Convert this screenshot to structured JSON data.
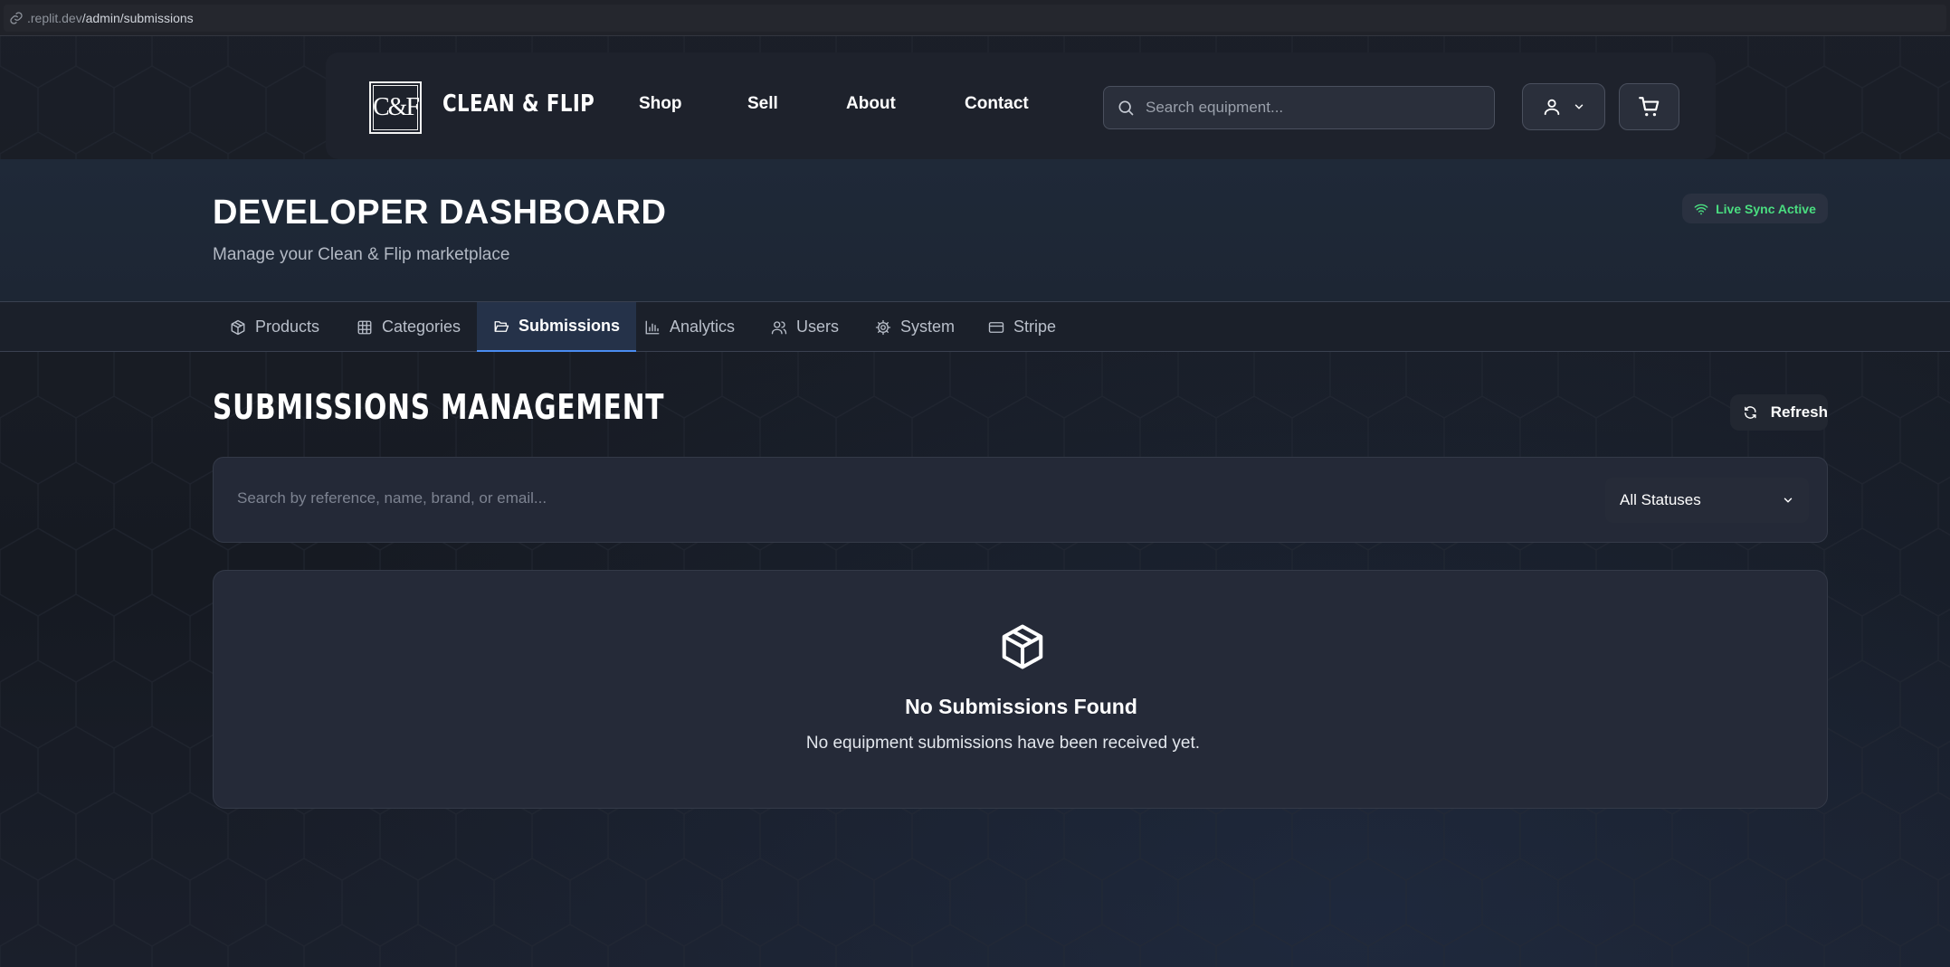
{
  "browser": {
    "url_prefix": ".replit.dev",
    "url_path": "/admin/submissions"
  },
  "header": {
    "logo_text": "C&F",
    "brand": "CLEAN & FLIP",
    "nav": [
      "Shop",
      "Sell",
      "About",
      "Contact"
    ],
    "search_placeholder": "Search equipment..."
  },
  "hero": {
    "title": "DEVELOPER DASHBOARD",
    "subtitle": "Manage your Clean & Flip marketplace",
    "live_badge": "Live Sync Active"
  },
  "tabs": [
    {
      "label": "Products",
      "icon": "package-icon"
    },
    {
      "label": "Categories",
      "icon": "grid-icon"
    },
    {
      "label": "Submissions",
      "icon": "folder-open-icon",
      "active": true
    },
    {
      "label": "Analytics",
      "icon": "bar-chart-icon"
    },
    {
      "label": "Users",
      "icon": "users-icon"
    },
    {
      "label": "System",
      "icon": "gear-icon"
    },
    {
      "label": "Stripe",
      "icon": "credit-card-icon"
    }
  ],
  "section": {
    "title": "SUBMISSIONS MANAGEMENT",
    "refresh_label": "Refresh"
  },
  "filters": {
    "search_placeholder": "Search by reference, name, brand, or email...",
    "status_value": "All Statuses"
  },
  "empty_state": {
    "icon": "package-icon",
    "title": "No Submissions Found",
    "message": "No equipment submissions have been received yet."
  },
  "colors": {
    "accent": "#4a8cf0",
    "live_green": "#4ade80",
    "background": "#161a23"
  }
}
